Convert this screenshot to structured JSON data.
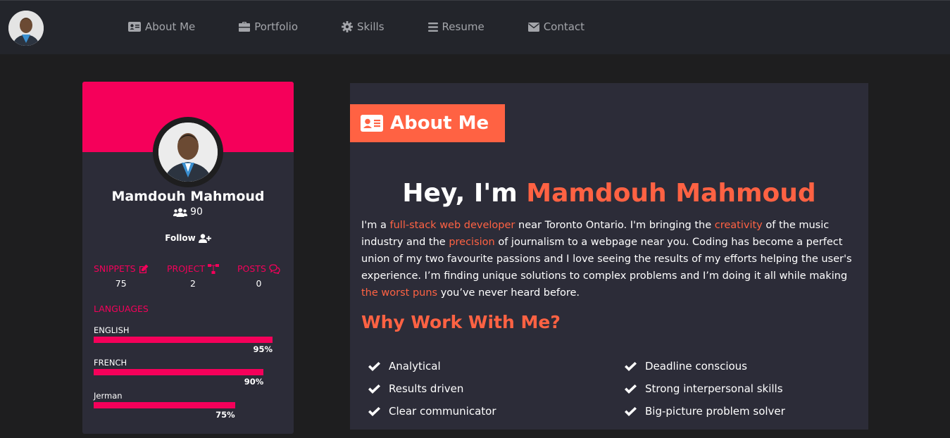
{
  "navbar": {
    "links": [
      {
        "label": "About Me",
        "icon": "id-card-icon"
      },
      {
        "label": "Portfolio",
        "icon": "briefcase-icon"
      },
      {
        "label": "Skills",
        "icon": "gear-icon"
      },
      {
        "label": "Resume",
        "icon": "bars-icon"
      },
      {
        "label": "Contact",
        "icon": "envelope-icon"
      }
    ]
  },
  "profile": {
    "name": "Mamdouh Mahmoud",
    "followers": "90",
    "follow_label": "Follow",
    "stats": [
      {
        "label": "SNIPPETS",
        "value": "75",
        "icon": "edit-icon"
      },
      {
        "label": "PROJECT",
        "value": "2",
        "icon": "sitemap-icon"
      },
      {
        "label": "POSTS",
        "value": "0",
        "icon": "comments-icon"
      }
    ],
    "languages_title": "LANGUAGES",
    "languages": [
      {
        "name": "ENGLISH",
        "percent_label": "95%",
        "level": 1.0
      },
      {
        "name": "FRENCH",
        "percent_label": "90%",
        "level": 0.95
      },
      {
        "name": "Jerman",
        "percent_label": "75%",
        "level": 0.79
      }
    ]
  },
  "about": {
    "section_title": "About Me",
    "greeting": "Hey, I'm",
    "name": "Mamdouh Mahmoud",
    "bio": {
      "t1": "I'm a ",
      "h1": "full-stack web developer",
      "t2": " near Toronto Ontario. I'm bringing the ",
      "h2": "creativity",
      "t3": " of the music industry and the ",
      "h3": "precision",
      "t4": " of journalism to a webpage near you. Coding has become a perfect union of my two favourite passions and I love seeing the results of my efforts helping the user's experience. I’m finding unique solutions to complex problems and I’m doing it all while making ",
      "h4": "the worst puns",
      "t5": " you’ve never heard before."
    },
    "why_title": "Why Work With Me?",
    "reasons_left": [
      "Analytical",
      "Results driven",
      "Clear communicator"
    ],
    "reasons_right": [
      "Deadline conscious",
      "Strong interpersonal skills",
      "Big-picture problem solver"
    ]
  },
  "colors": {
    "accent_pink": "#f5005a",
    "accent_orange": "#ff6243",
    "panel_bg": "#2c2c38",
    "page_bg": "#1e1e1f",
    "navbar_bg": "#23252b"
  }
}
